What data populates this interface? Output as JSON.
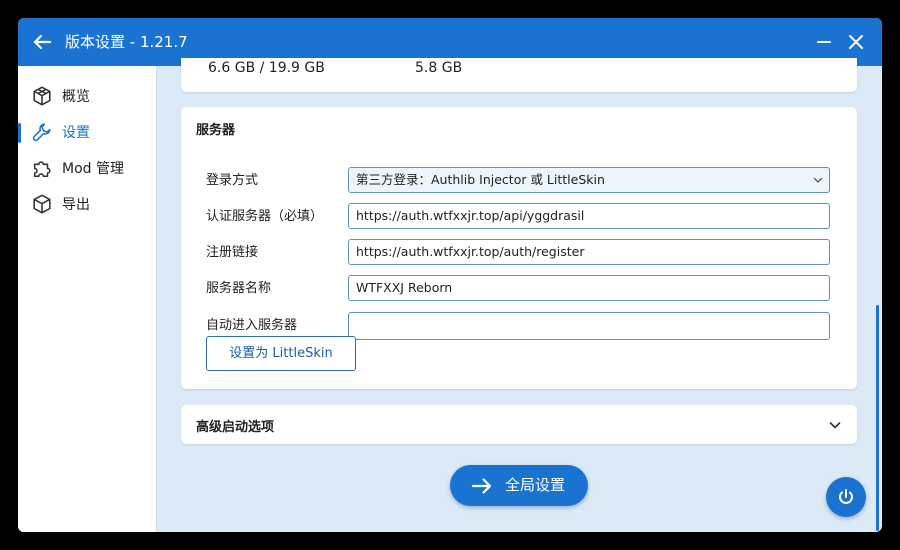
{
  "window": {
    "title": "版本设置 - 1.21.7"
  },
  "sidebar": {
    "items": [
      {
        "label": "概览",
        "icon": "cube-outline-icon"
      },
      {
        "label": "设置",
        "icon": "wrench-icon",
        "active": true
      },
      {
        "label": "Mod 管理",
        "icon": "puzzle-icon"
      },
      {
        "label": "导出",
        "icon": "package-icon"
      }
    ]
  },
  "memory": {
    "used_total": "6.6 GB / 19.9 GB",
    "available": "5.8 GB"
  },
  "server": {
    "section_title": "服务器",
    "login_method_label": "登录方式",
    "login_method_value": "第三方登录：Authlib Injector 或 LittleSkin",
    "auth_server_label": "认证服务器（必填）",
    "auth_server_value": "https://auth.wtfxxjr.top/api/yggdrasil",
    "register_link_label": "注册链接",
    "register_link_value": "https://auth.wtfxxjr.top/auth/register",
    "server_name_label": "服务器名称",
    "server_name_value": "WTFXXJ Reborn",
    "auto_join_label": "自动进入服务器",
    "auto_join_value": "",
    "set_littleskin_button": "设置为 LittleSkin"
  },
  "advanced": {
    "title": "高级启动选项"
  },
  "global_settings_button": "全局设置",
  "colors": {
    "accent": "#1a73d1",
    "background": "#dce9f6",
    "card": "#ffffff"
  }
}
